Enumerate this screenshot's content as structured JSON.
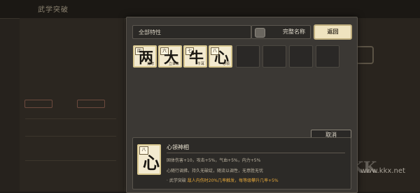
{
  "background": {
    "title": "武学突破",
    "watermark": "www.kkx.net"
  },
  "modal": {
    "filter_label": "全部特性",
    "toggle_label": "完整名称",
    "return_label": "返回",
    "cards": [
      {
        "num": "四",
        "glyph": "两",
        "sub": "清寒"
      },
      {
        "num": "六",
        "glyph": "大",
        "sub": "立谁来"
      },
      {
        "num": "七",
        "glyph": "牛",
        "sub": "牛耳"
      },
      {
        "num": "八",
        "glyph": "心",
        "sub": "心领"
      }
    ],
    "empty_slots": 4
  },
  "detail": {
    "cancel_label": "取消",
    "card": {
      "num": "八",
      "glyph": "心"
    },
    "name": "心领神相",
    "line1": "固体伤害+10，攻击+5%，气血+5%，内力+5%",
    "line2": "心随行调拂，持久无破绽，随流以调性，无意胜无忧",
    "line3_prefix": "· 武学突破",
    "line3_highlight": "敌人内伤时20%几率触发，每等级攀升几率+5%"
  },
  "colors": {
    "accent_gold": "#e3a63a",
    "card_face": "#f3ead0",
    "return_button": "#efe3bf"
  }
}
